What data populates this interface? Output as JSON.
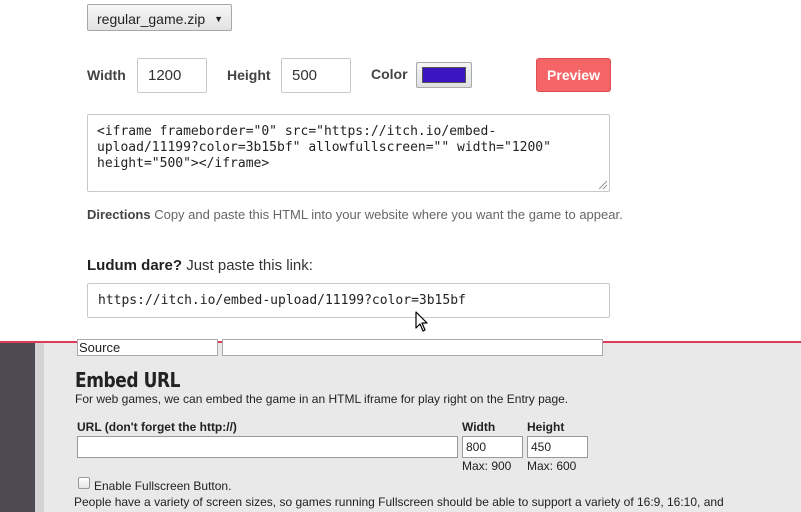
{
  "embed_panel": {
    "file_select": {
      "value": "regular_game.zip"
    },
    "width_label": "Width",
    "width_value": "1200",
    "height_label": "Height",
    "height_value": "500",
    "color_label": "Color",
    "color_value": "#3b15bf",
    "preview_label": "Preview",
    "embed_code_line1": "<iframe frameborder=\"0\" src=\"https://itch.io/embed-",
    "embed_code_line2": "upload/11199?color=3b15bf\" allowfullscreen=\"\" width=\"1200\"",
    "embed_code_line3": "height=\"500\"></iframe>",
    "directions_label": "Directions",
    "directions_text": "Copy and paste this HTML into your website where you want the game to appear.",
    "ludum_label": "Ludum dare?",
    "ludum_text": "Just paste this link:",
    "ludum_link": "https://itch.io/embed-upload/11199?color=3b15bf"
  },
  "entry_form": {
    "source_value": "Source",
    "embed_title": "Embed URL",
    "embed_desc": "For web games, we can embed the game in an HTML iframe for play right on the Entry page.",
    "url_label": "URL (don't forget the http://)",
    "url_value": "",
    "width_label": "Width",
    "width_value": "800",
    "width_max": "Max: 900",
    "height_label": "Height",
    "height_value": "450",
    "height_max": "Max: 600",
    "fullscreen_label": "Enable Fullscreen Button.",
    "fullscreen_checked": false,
    "fullscreen_note": "People have a variety of screen sizes, so games running Fullscreen should be able to support a variety of 16:9, 16:10, and"
  },
  "colors": {
    "preview_button": "#f56466",
    "divider": "#e03a55",
    "swatch": "#3b15bf"
  }
}
